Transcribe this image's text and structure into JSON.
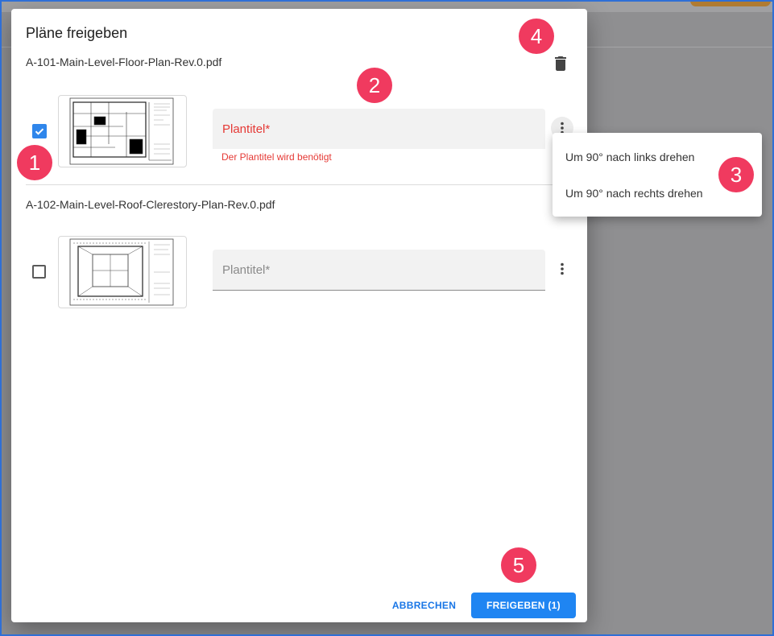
{
  "dialog": {
    "title": "Pläne freigeben",
    "files": [
      {
        "filename": "A-101-Main-Level-Floor-Plan-Rev.0.pdf",
        "checked": true,
        "field_label": "Plantitel*",
        "error": "Der Plantitel wird benötigt"
      },
      {
        "filename": "A-102-Main-Level-Roof-Clerestory-Plan-Rev.0.pdf",
        "checked": false,
        "field_label": "Plantitel*"
      }
    ],
    "cancel_label": "ABBRECHEN",
    "submit_label": "FREIGEBEN (1)"
  },
  "context_menu": {
    "items": [
      "Um 90° nach links drehen",
      "Um 90° nach rechts drehen"
    ]
  },
  "callouts": [
    "1",
    "2",
    "3",
    "4",
    "5"
  ],
  "colors": {
    "accent": "#1f85f2",
    "error": "#e53935",
    "callout": "#f03a5f",
    "overlay": "#8f8f91",
    "frame": "#2f6fd6"
  }
}
